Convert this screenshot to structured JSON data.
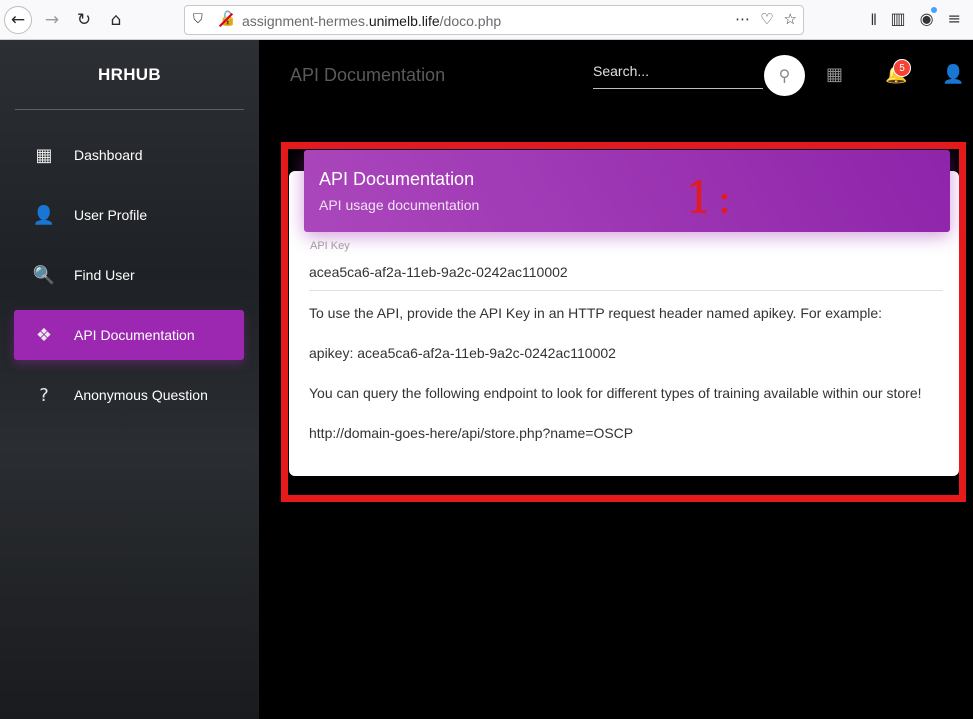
{
  "browser": {
    "url_prefix": "assignment-hermes.",
    "url_domain": "unimelb.life",
    "url_path": "/doco.php"
  },
  "sidebar": {
    "brand": "HRHUB",
    "items": [
      {
        "label": "Dashboard",
        "icon": "dashboard-icon"
      },
      {
        "label": "User Profile",
        "icon": "person-icon"
      },
      {
        "label": "Find User",
        "icon": "search-icon"
      },
      {
        "label": "API Documentation",
        "icon": "api-icon",
        "active": true
      },
      {
        "label": "Anonymous Question",
        "icon": "question-icon"
      }
    ]
  },
  "header": {
    "page_title": "API Documentation",
    "search_placeholder": "Search...",
    "notification_count": "5"
  },
  "card": {
    "title": "API Documentation",
    "subtitle": "API usage documentation",
    "api_key_label": "API Key",
    "api_key_value": "acea5ca6-af2a-11eb-9a2c-0242ac110002",
    "paragraphs": [
      "To use the API, provide the API Key in an HTTP request header named apikey. For example:",
      "apikey: acea5ca6-af2a-11eb-9a2c-0242ac110002",
      "You can query the following endpoint to look for different types of training available within our store!",
      "http://domain-goes-here/api/store.php?name=OSCP"
    ]
  },
  "annotation": {
    "label": "1:",
    "color": "#e61a1a"
  },
  "colors": {
    "accent": "#9c27b0",
    "badge": "#f44336"
  }
}
